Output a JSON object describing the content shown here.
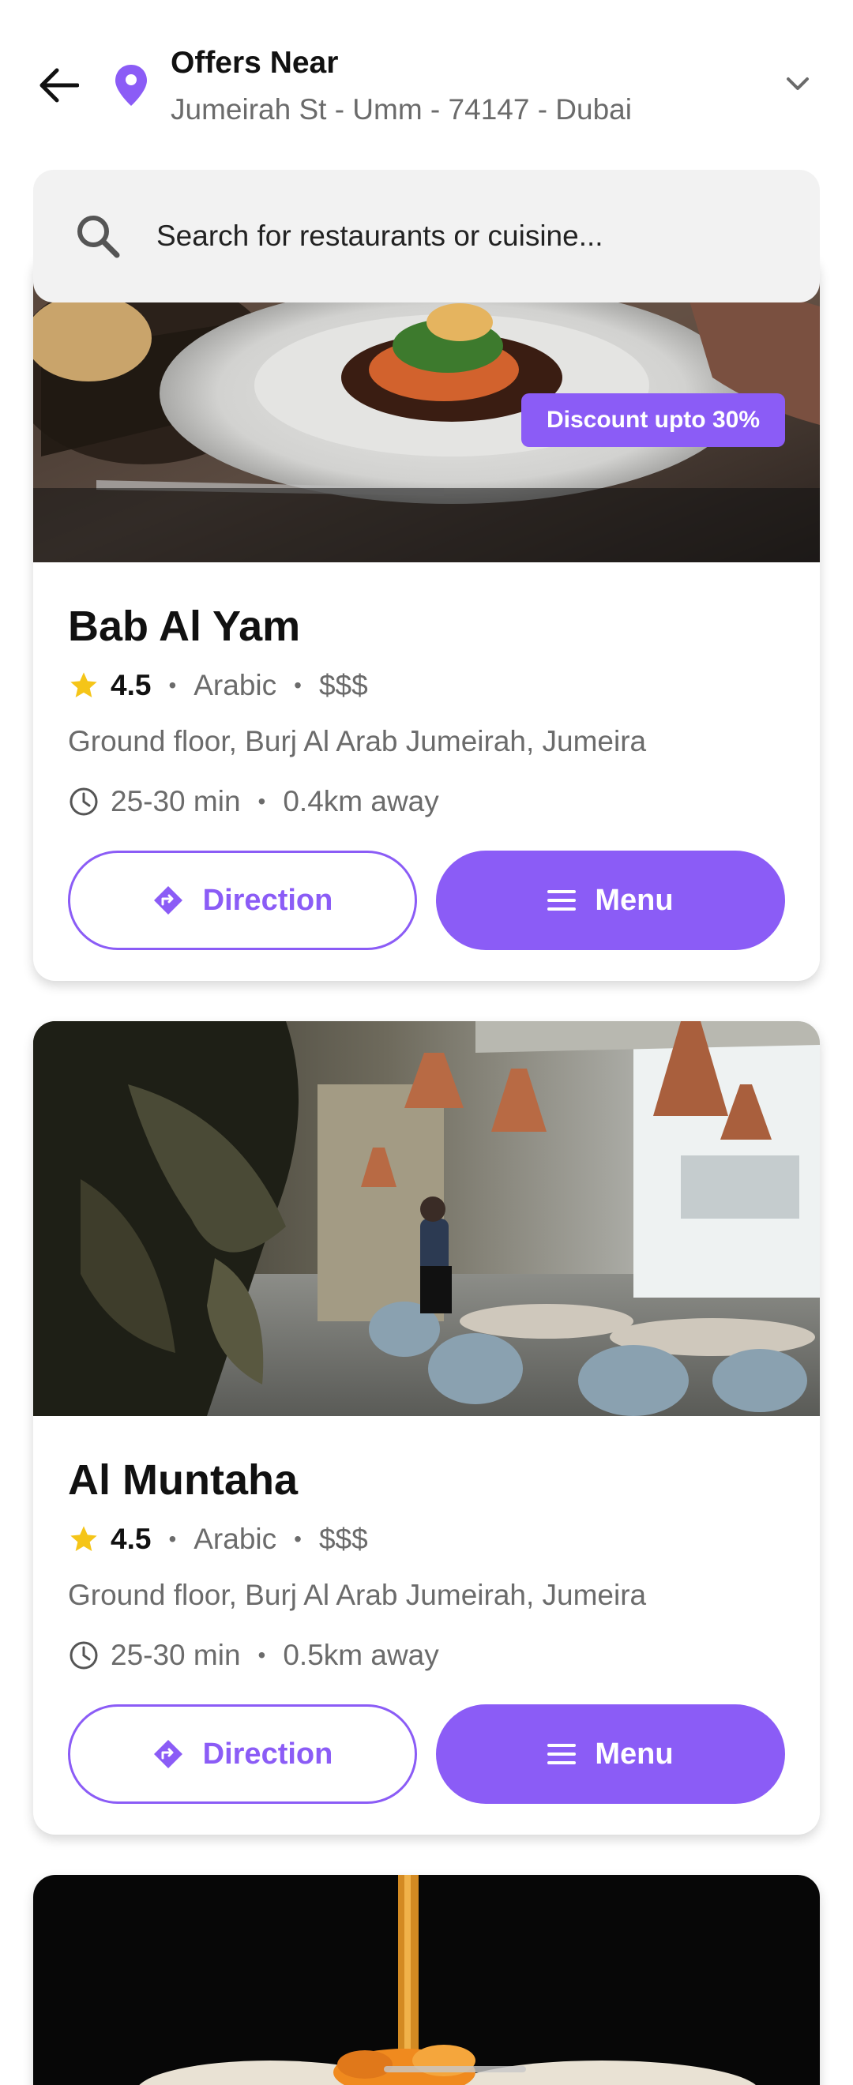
{
  "header": {
    "title": "Offers Near",
    "address": "Jumeirah St - Umm - 74147 - Dubai",
    "back_icon": "arrow-left-icon",
    "location_icon": "map-pin-icon",
    "dropdown_icon": "chevron-down-icon"
  },
  "search": {
    "placeholder": "Search for restaurants or cuisine..."
  },
  "restaurants": [
    {
      "badge": "Discount upto 30%",
      "name": "Bab Al Yam",
      "rating": "4.5",
      "cuisine": "Arabic",
      "price": "$$$",
      "address": "Ground floor, Burj Al Arab Jumeirah, Jumeira",
      "time": "25-30 min",
      "distance": "0.4km away",
      "direction_label": "Direction",
      "menu_label": "Menu"
    },
    {
      "name": "Al Muntaha",
      "rating": "4.5",
      "cuisine": "Arabic",
      "price": "$$$",
      "address": "Ground floor, Burj Al Arab Jumeirah, Jumeira",
      "time": "25-30 min",
      "distance": "0.5km away",
      "direction_label": "Direction",
      "menu_label": "Menu"
    }
  ],
  "colors": {
    "accent": "#8b5cf6",
    "star": "#f5c518"
  }
}
